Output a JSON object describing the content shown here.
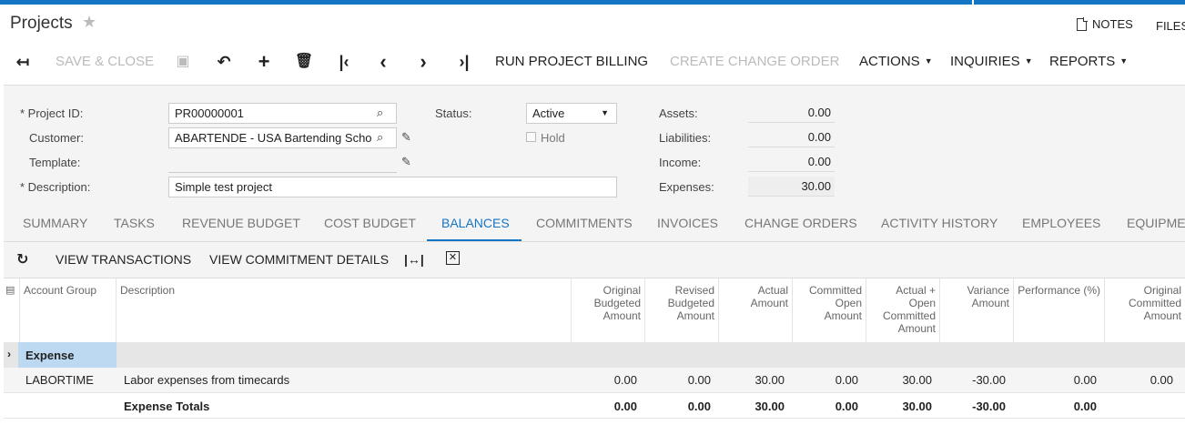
{
  "app": {
    "title": "Projects",
    "notes_label": "NOTES",
    "files_label": "FILES"
  },
  "toolbar": {
    "save_close": "SAVE & CLOSE",
    "run_project_billing": "RUN PROJECT BILLING",
    "create_change_order": "CREATE CHANGE ORDER",
    "actions": "ACTIONS",
    "inquiries": "INQUIRIES",
    "reports": "REPORTS"
  },
  "form": {
    "project_id_label": "* Project ID:",
    "project_id_value": "PR00000001",
    "customer_label": "Customer:",
    "customer_value": "ABARTENDE - USA Bartending Scho",
    "template_label": "Template:",
    "template_value": "",
    "description_label": "* Description:",
    "description_value": "Simple test project",
    "status_label": "Status:",
    "status_value": "Active",
    "hold_label": "Hold",
    "assets_label": "Assets:",
    "assets_value": "0.00",
    "liabilities_label": "Liabilities:",
    "liabilities_value": "0.00",
    "income_label": "Income:",
    "income_value": "0.00",
    "expenses_label": "Expenses:",
    "expenses_value": "30.00"
  },
  "tabs": [
    "SUMMARY",
    "TASKS",
    "REVENUE BUDGET",
    "COST BUDGET",
    "BALANCES",
    "COMMITMENTS",
    "INVOICES",
    "CHANGE ORDERS",
    "ACTIVITY HISTORY",
    "EMPLOYEES",
    "EQUIPMENT"
  ],
  "active_tab": "BALANCES",
  "subtoolbar": {
    "view_transactions": "VIEW TRANSACTIONS",
    "view_commitment_details": "VIEW COMMITMENT DETAILS"
  },
  "grid": {
    "headers": {
      "account_group": "Account Group",
      "description": "Description",
      "original_budgeted": "Original Budgeted Amount",
      "revised_budgeted": "Revised Budgeted Amount",
      "actual": "Actual Amount",
      "committed_open": "Committed Open Amount",
      "actual_open_committed": "Actual + Open Committed Amount",
      "variance": "Variance Amount",
      "performance": "Performance (%)",
      "original_committed": "Original Committed Amount"
    },
    "group_label": "Expense",
    "row": {
      "account_group": "LABORTIME",
      "description": "Labor expenses from timecards",
      "original_budgeted": "0.00",
      "revised_budgeted": "0.00",
      "actual": "30.00",
      "committed_open": "0.00",
      "actual_open_committed": "30.00",
      "variance": "-30.00",
      "performance": "0.00",
      "original_committed": "0.00"
    },
    "totals": {
      "label": "Expense Totals",
      "original_budgeted": "0.00",
      "revised_budgeted": "0.00",
      "actual": "30.00",
      "committed_open": "0.00",
      "actual_open_committed": "30.00",
      "variance": "-30.00",
      "performance": "0.00"
    }
  }
}
